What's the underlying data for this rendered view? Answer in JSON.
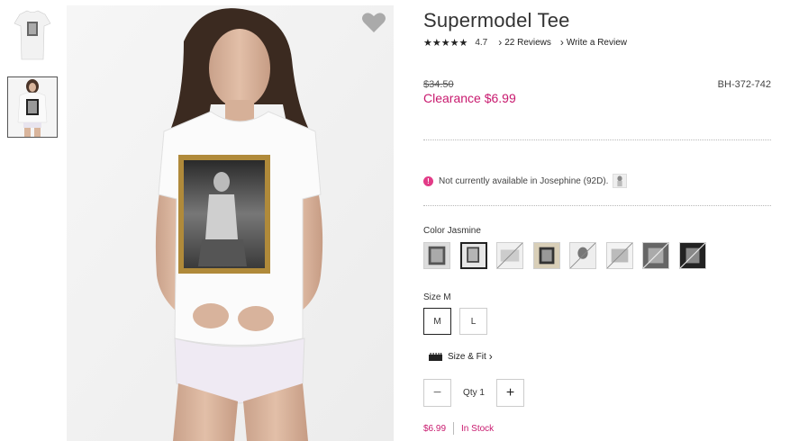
{
  "product": {
    "title": "Supermodel Tee",
    "rating_stars": "★★★★★",
    "rating_value": "4.7",
    "reviews_link": "22 Reviews",
    "write_review_link": "Write a Review",
    "old_price": "$34.50",
    "clearance_price": "Clearance $6.99",
    "sku": "BH-372-742"
  },
  "availability": {
    "icon": "alert-icon",
    "message": "Not currently available in Josephine (92D)."
  },
  "color": {
    "label": "Color Jasmine",
    "swatch_count": 8,
    "selected_index": 1
  },
  "size": {
    "label": "Size M",
    "options": [
      "M",
      "L"
    ],
    "selected": "M"
  },
  "size_fit": {
    "label": "Size & Fit",
    "icon": "ruler-icon"
  },
  "quantity": {
    "minus": "−",
    "label": "Qty 1",
    "plus": "+"
  },
  "footer": {
    "price": "$6.99",
    "stock": "In Stock"
  },
  "colors": {
    "accent": "#c8196e",
    "alert": "#e23b87"
  }
}
